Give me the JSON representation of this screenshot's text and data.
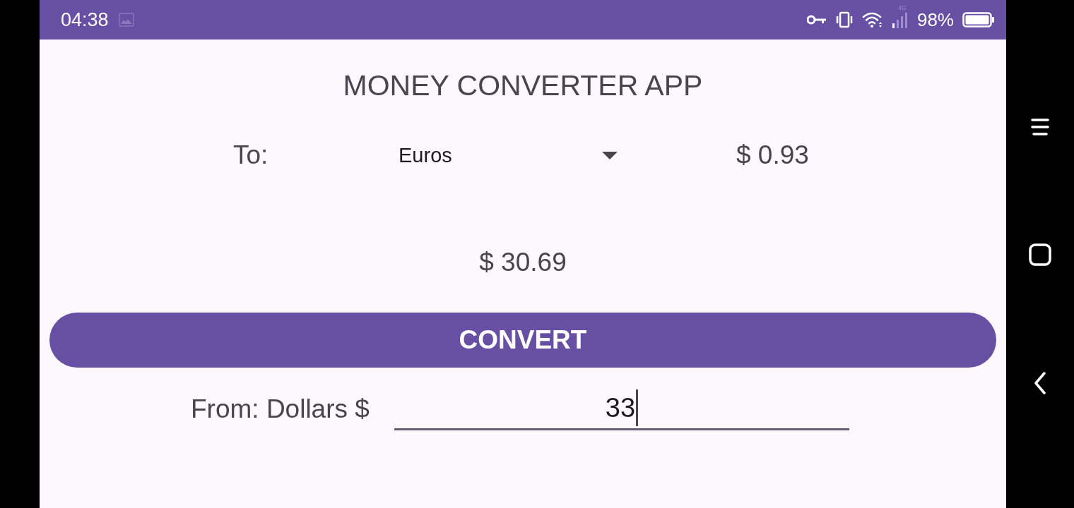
{
  "status_bar": {
    "time": "04:38",
    "network_type": "4G",
    "battery": "98%"
  },
  "title": "MONEY CONVERTER APP",
  "to_row": {
    "label": "To:",
    "currency_dropdown": {
      "value": "Euros"
    },
    "rate": "$ 0.93"
  },
  "result": "$ 30.69",
  "convert_button": {
    "label": "CONVERT"
  },
  "from_row": {
    "label": "From: Dollars $",
    "amount_field": {
      "value": "33",
      "focused": true
    }
  }
}
